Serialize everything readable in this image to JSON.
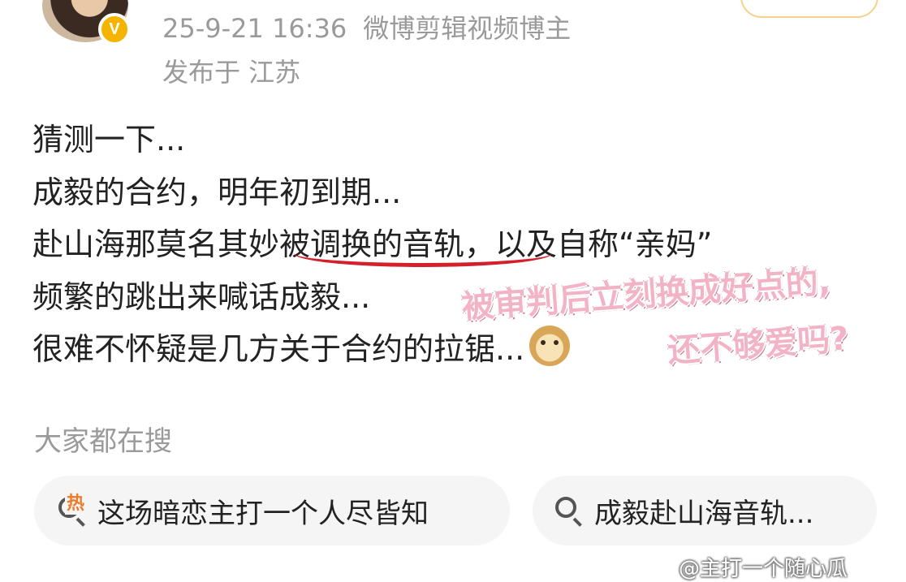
{
  "post": {
    "meta": {
      "timestamp": "25-9-21 16:36",
      "author_tag": "微博剪辑视频博主",
      "location": "发布于 江苏"
    },
    "verified_badge": "V",
    "lines": [
      "猜测一下...",
      "成毅的合约，明年初到期...",
      "赴山海那莫名其妙被调换的音轨，以及自称“亲妈”",
      "频繁的跳出来喊话成毅...",
      "很难不怀疑是几方关于合约的拉锯..."
    ],
    "emoji_icon": "doge-emoji-icon"
  },
  "annotation": {
    "line1": "被审判后立刻换成好点的,",
    "line2": "还不够爱吗?"
  },
  "search": {
    "header": "大家都在搜",
    "hot_label": "热",
    "items": [
      {
        "label": "这场暗恋主打一个人尽皆知",
        "icon": "hot-search-icon"
      },
      {
        "label": "成毅赴山海音轨...",
        "icon": "search-icon"
      }
    ]
  },
  "watermark": "@主打一个随心瓜",
  "colors": {
    "meta_gray": "#9a9a9a",
    "underline_red": "#d3202a",
    "annotation_pink": "#f3b3c6",
    "hot_orange": "#f07a2b",
    "pill_bg": "#f5f5f5",
    "badge_gold": "#f4b400"
  }
}
